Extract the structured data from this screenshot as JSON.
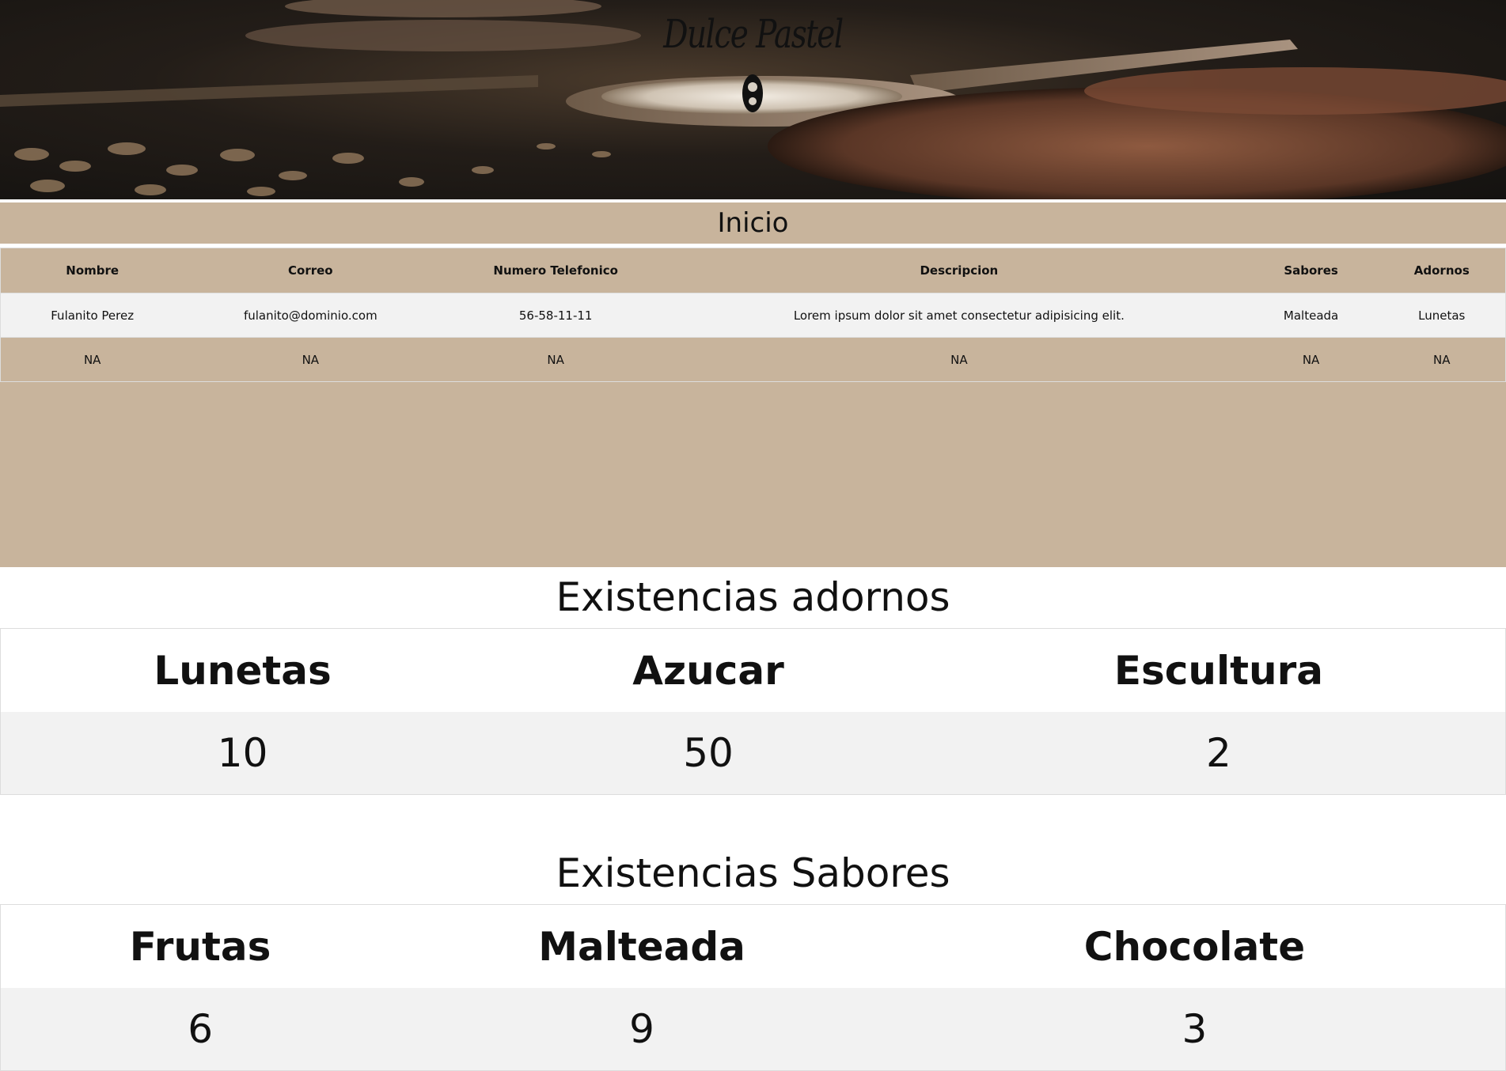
{
  "brand": {
    "logo_text": "Dulce Pastel"
  },
  "nav": {
    "inicio": "Inicio"
  },
  "orders": {
    "headers": [
      "Nombre",
      "Correo",
      "Numero  Telefonico",
      "Descripcion",
      "Sabores",
      "Adornos"
    ],
    "rows": [
      [
        "Fulanito Perez",
        "fulanito@dominio.com",
        "56-58-11-11",
        "Lorem ipsum dolor sit amet consectetur adipisicing elit.",
        "Malteada",
        "Lunetas"
      ],
      [
        "NA",
        "NA",
        "NA",
        "NA",
        "NA",
        "NA"
      ]
    ]
  },
  "adornos": {
    "title": "Existencias adornos",
    "headers": [
      "Lunetas",
      "Azucar",
      "Escultura"
    ],
    "values": [
      "10",
      "50",
      "2"
    ]
  },
  "sabores": {
    "title": "Existencias Sabores",
    "headers": [
      "Frutas",
      "Malteada",
      "Chocolate"
    ],
    "values": [
      "6",
      "9",
      "3"
    ]
  },
  "colors": {
    "tan": "#c8b49c",
    "light_row": "#f2f2f2",
    "banner_dark": "#1c1a18"
  }
}
